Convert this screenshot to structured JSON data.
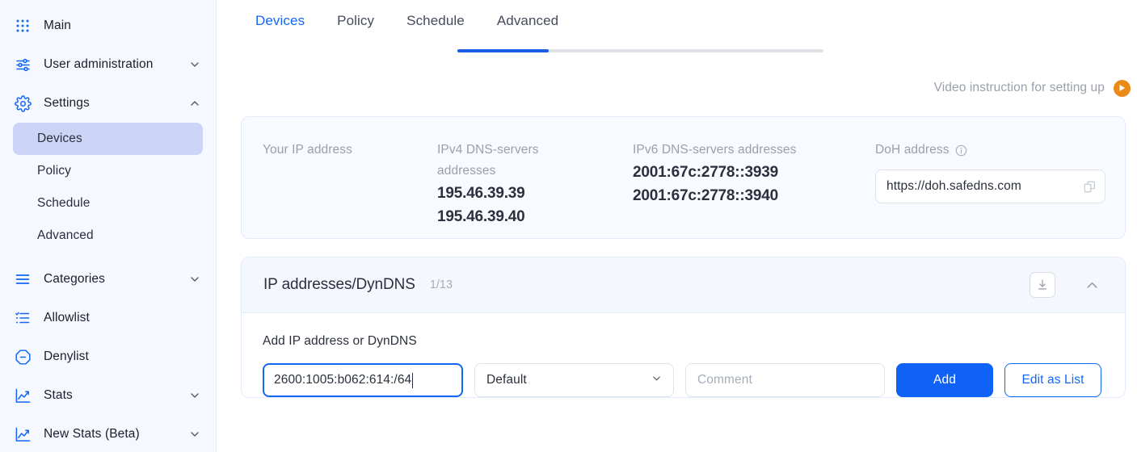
{
  "sidebar": {
    "items": [
      {
        "label": "Main",
        "icon": "grid-dots-icon",
        "expandable": false
      },
      {
        "label": "User administration",
        "icon": "sliders-icon",
        "expandable": true,
        "chevron": "down"
      },
      {
        "label": "Settings",
        "icon": "gear-icon",
        "expandable": true,
        "chevron": "up"
      }
    ],
    "settings_children": [
      {
        "label": "Devices",
        "active": true
      },
      {
        "label": "Policy",
        "active": false
      },
      {
        "label": "Schedule",
        "active": false
      },
      {
        "label": "Advanced",
        "active": false
      }
    ],
    "items_lower": [
      {
        "label": "Categories",
        "icon": "menu-lines-icon",
        "expandable": true,
        "chevron": "down"
      },
      {
        "label": "Allowlist",
        "icon": "checklist-icon",
        "expandable": false
      },
      {
        "label": "Denylist",
        "icon": "octagon-minus-icon",
        "expandable": false
      },
      {
        "label": "Stats",
        "icon": "chart-line-icon",
        "expandable": true,
        "chevron": "down"
      },
      {
        "label": "New Stats (Beta)",
        "icon": "chart-line-icon",
        "expandable": true,
        "chevron": "down"
      }
    ]
  },
  "tabs": [
    {
      "label": "Devices",
      "active": true
    },
    {
      "label": "Policy",
      "active": false
    },
    {
      "label": "Schedule",
      "active": false
    },
    {
      "label": "Advanced",
      "active": false
    }
  ],
  "video": {
    "label": "Video instruction for setting up",
    "icon": "play-circle-icon",
    "accent_color": "#e98a19"
  },
  "info_card": {
    "your_ip": {
      "label": "Your IP address",
      "value": ""
    },
    "ipv4": {
      "label": "IPv4 DNS-servers addresses",
      "values": [
        "195.46.39.39",
        "195.46.39.40"
      ]
    },
    "ipv6": {
      "label": "IPv6 DNS-servers addresses",
      "values": [
        "2001:67c:2778::3939",
        "2001:67c:2778::3940"
      ]
    },
    "doh": {
      "label": "DoH address",
      "info_icon": "info-circle-icon",
      "value": "https://doh.safedns.com",
      "copy_icon": "copy-icon"
    }
  },
  "dyndns": {
    "title": "IP addresses/DynDNS",
    "count": "1/13",
    "download_icon": "download-icon",
    "collapse_icon": "chevron-up-icon",
    "add_label": "Add IP address or DynDNS",
    "ip_input": {
      "value": "2600:1005:b062:614:/64",
      "placeholder": ""
    },
    "policy_select": {
      "value": "Default",
      "icon": "chevron-down-icon"
    },
    "comment_input": {
      "value": "",
      "placeholder": "Comment"
    },
    "add_button": "Add",
    "edit_button": "Edit as List"
  },
  "colors": {
    "accent_blue": "#1366f5",
    "add_button_blue": "#0f62f5",
    "tab_indicator": "#1a5ce8",
    "sidebar_bg": "#f5f8fe",
    "active_item_bg": "#ccd5f6",
    "card_bg": "#f7faff",
    "orange": "#e98a19"
  }
}
